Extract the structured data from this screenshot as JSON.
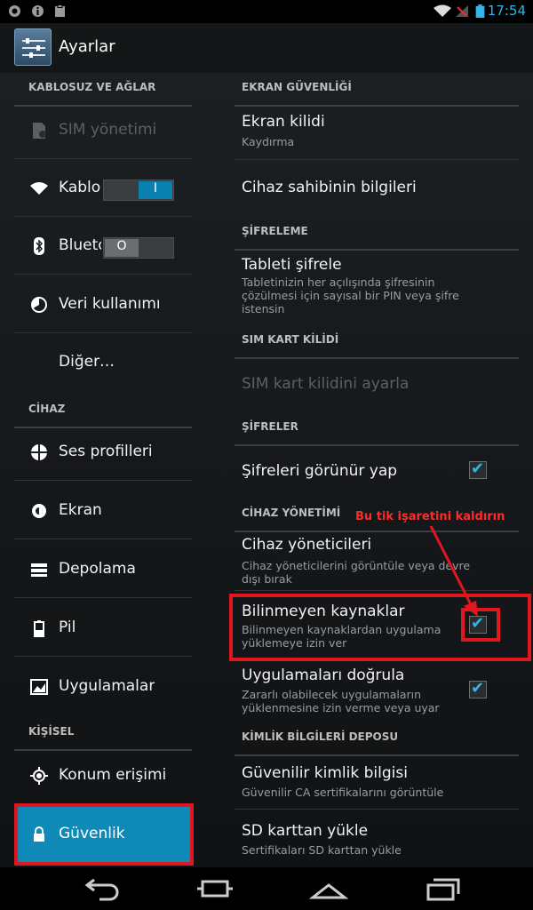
{
  "status_bar": {
    "time": "17:54",
    "left_icons": [
      "notification-icon",
      "info-icon",
      "clipboard-icon"
    ],
    "right_icons": [
      "wifi-icon",
      "no-signal-icon",
      "battery-icon"
    ]
  },
  "action_bar": {
    "title": "Ayarlar",
    "icon": "settings-app-icon"
  },
  "left_pane": {
    "sections": [
      {
        "header": "KABLOSUZ VE AĞLAR"
      },
      {
        "header": "CİHAZ"
      },
      {
        "header": "KİŞİSEL"
      }
    ],
    "items": [
      {
        "label": "SIM yönetimi",
        "icon": "sim-icon",
        "disabled": true
      },
      {
        "label": "Kablosuz",
        "icon": "wifi-icon",
        "toggle": "on",
        "toggle_text": "I"
      },
      {
        "label": "Bluetooth",
        "icon": "bluetooth-icon",
        "toggle": "off",
        "toggle_text": "O"
      },
      {
        "label": "Veri kullanımı",
        "icon": "data-usage-icon"
      },
      {
        "label": "Diğer…",
        "icon": ""
      },
      {
        "label": "Ses profilleri",
        "icon": "sound-profiles-icon"
      },
      {
        "label": "Ekran",
        "icon": "display-icon"
      },
      {
        "label": "Depolama",
        "icon": "storage-icon"
      },
      {
        "label": "Pil",
        "icon": "battery-icon"
      },
      {
        "label": "Uygulamalar",
        "icon": "apps-icon"
      },
      {
        "label": "Konum erişimi",
        "icon": "location-icon"
      },
      {
        "label": "Güvenlik",
        "icon": "lock-icon",
        "selected": true
      }
    ]
  },
  "right_pane": {
    "headers": [
      "EKRAN GÜVENLİĞİ",
      "ŞİFRELEME",
      "SIM KART KİLİDİ",
      "ŞİFRELER",
      "CİHAZ YÖNETİMİ",
      "KİMLİK BİLGİLERİ DEPOSU"
    ],
    "items": [
      {
        "title": "Ekran kilidi",
        "subtitle": "Kaydırma"
      },
      {
        "title": "Cihaz sahibinin bilgileri",
        "subtitle": ""
      },
      {
        "title": "Tableti şifrele",
        "subtitle": "Tabletinizin her açılışında şifresinin çözülmesi için sayısal bir PIN veya şifre istensin"
      },
      {
        "title": "SIM kart kilidini ayarla",
        "subtitle": "",
        "disabled": true
      },
      {
        "title": "Şifreleri görünür yap",
        "subtitle": "",
        "checked": true
      },
      {
        "title": "Cihaz yöneticileri",
        "subtitle": "Cihaz yöneticilerini görüntüle veya devre dışı bırak"
      },
      {
        "title": "Bilinmeyen kaynaklar",
        "subtitle": "Bilinmeyen kaynaklardan uygulama yüklemeye izin ver",
        "checked": true
      },
      {
        "title": "Uygulamaları doğrula",
        "subtitle": "Zararlı olabilecek uygulamaların yüklenmesine izin verme veya uyar",
        "checked": true
      },
      {
        "title": "Güvenilir kimlik bilgisi",
        "subtitle": "Güvenilir CA sertifikalarını görüntüle"
      },
      {
        "title": "SD karttan yükle",
        "subtitle": "Sertifikaları SD karttan yükle"
      }
    ]
  },
  "annotation": {
    "text": "Bu tik işaretini kaldırın",
    "color": "#e1161f"
  },
  "nav_bar": {
    "buttons": [
      "back-icon",
      "screenshot-icon",
      "home-icon",
      "recent-apps-icon"
    ]
  },
  "colors": {
    "accent": "#33b5e5",
    "selected": "#0f89b8",
    "annotation": "#e1161f"
  }
}
